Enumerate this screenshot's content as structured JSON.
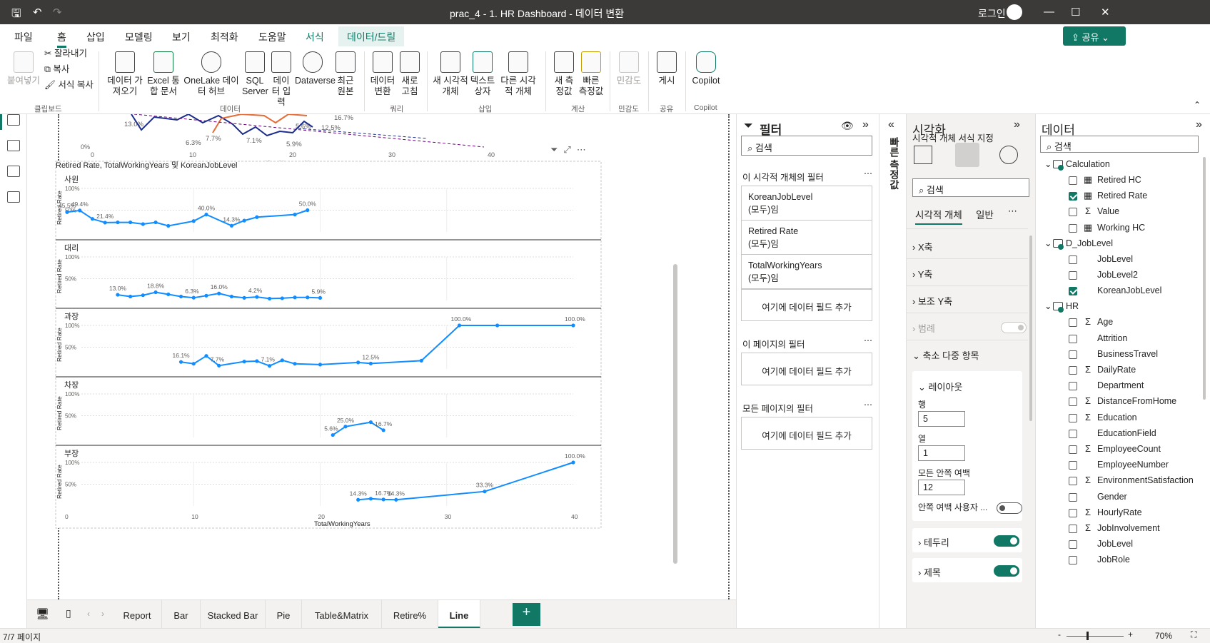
{
  "window": {
    "title": "prac_4 - 1. HR Dashboard - 데이터 변환",
    "login": "로그인"
  },
  "tabs": [
    "파일",
    "홈",
    "삽입",
    "모델링",
    "보기",
    "최적화",
    "도움말",
    "서식",
    "데이터/드릴"
  ],
  "active_tab": "홈",
  "share_label": "공유",
  "ribbon": {
    "clipboard": {
      "paste": "붙여넣기",
      "cut": "잘라내기",
      "copy": "복사",
      "format_copy": "서식 복사",
      "group": "클립보드"
    },
    "data": {
      "get_data": "데이터 가져오기",
      "excel": "Excel 통합 문서",
      "onelake": "OneLake 데이터 허브",
      "sql": "SQL Server",
      "enter": "데이터 입력",
      "dataverse": "Dataverse",
      "recent": "최근 원본",
      "group": "데이터"
    },
    "query": {
      "transform": "데이터 변환",
      "refresh": "새로 고침",
      "group": "쿼리"
    },
    "insert": {
      "new_visual": "새 시각적 개체",
      "textbox": "텍스트 상자",
      "other_visual": "다른 시각적 개체",
      "group": "삽입"
    },
    "calc": {
      "new_measure": "새 측정값",
      "quick_measure": "빠른 측정값",
      "group": "계산"
    },
    "sensitivity": {
      "label": "민감도",
      "group": "민감도"
    },
    "share": {
      "publish": "게시",
      "group": "공유"
    },
    "copilot": {
      "label": "Copilot",
      "group": "Copilot"
    }
  },
  "top_chart_fragment": {
    "labels": [
      "13.0%",
      "6.3%",
      "7.7%",
      "7.1%",
      "5.9%",
      "5.6%",
      "12.5%",
      "16.7%"
    ],
    "x_ticks": [
      "0",
      "10",
      "20",
      "30",
      "40"
    ],
    "y_tick": "0%",
    "xlabel": "TotalWorkingYears"
  },
  "visual": {
    "title": "Retired Rate, TotalWorkingYears 및 KoreanJobLevel",
    "xlabel": "TotalWorkingYears",
    "ylabel": "Retired Rate"
  },
  "chart_data": [
    {
      "type": "line",
      "title": "사원",
      "xlabel": "TotalWorkingYears",
      "ylabel": "Retired Rate",
      "xlim": [
        0,
        40
      ],
      "ylim": [
        0,
        1
      ],
      "y_ticks": [
        "100%",
        "50%"
      ],
      "x": [
        0,
        1,
        2,
        3,
        4,
        5,
        6,
        7,
        8,
        10,
        11,
        13,
        14,
        15,
        18,
        19
      ],
      "y": [
        0.455,
        0.494,
        0.3,
        0.214,
        0.22,
        0.22,
        0.18,
        0.22,
        0.14,
        0.25,
        0.4,
        0.143,
        0.26,
        0.34,
        0.4,
        0.5
      ],
      "labels": [
        {
          "x": 0,
          "text": "45.5%"
        },
        {
          "x": 1,
          "text": "49.4%"
        },
        {
          "x": 3,
          "text": "21.4%"
        },
        {
          "x": 11,
          "text": "40.0%"
        },
        {
          "x": 13,
          "text": "14.3%"
        },
        {
          "x": 19,
          "text": "50.0%"
        }
      ]
    },
    {
      "type": "line",
      "title": "대리",
      "xlabel": "TotalWorkingYears",
      "ylabel": "Retired Rate",
      "xlim": [
        0,
        40
      ],
      "ylim": [
        0,
        1
      ],
      "y_ticks": [
        "100%",
        "50%"
      ],
      "x": [
        4,
        5,
        6,
        7,
        8,
        9,
        10,
        11,
        12,
        13,
        14,
        15,
        16,
        17,
        18,
        19,
        20
      ],
      "y": [
        0.13,
        0.09,
        0.12,
        0.188,
        0.14,
        0.09,
        0.063,
        0.11,
        0.16,
        0.09,
        0.06,
        0.08,
        0.042,
        0.05,
        0.07,
        0.07,
        0.059
      ],
      "labels": [
        {
          "x": 4,
          "text": "13.0%"
        },
        {
          "x": 7,
          "text": "18.8%"
        },
        {
          "x": 10,
          "text": "6.3%"
        },
        {
          "x": 12,
          "text": "16.0%"
        },
        {
          "x": 15,
          "text": "4.2%"
        },
        {
          "x": 20,
          "text": "5.9%"
        }
      ]
    },
    {
      "type": "line",
      "title": "과장",
      "xlabel": "TotalWorkingYears",
      "ylabel": "Retired Rate",
      "xlim": [
        0,
        40
      ],
      "ylim": [
        0,
        1
      ],
      "y_ticks": [
        "100%",
        "50%"
      ],
      "x": [
        9,
        10,
        11,
        12,
        14,
        15,
        16,
        17,
        18,
        20,
        23,
        24,
        28,
        31,
        34,
        40
      ],
      "y": [
        0.161,
        0.12,
        0.3,
        0.077,
        0.17,
        0.18,
        0.071,
        0.2,
        0.12,
        0.1,
        0.15,
        0.125,
        0.19,
        1.0,
        1.0,
        1.0
      ],
      "labels": [
        {
          "x": 9,
          "text": "16.1%"
        },
        {
          "x": 12,
          "text": "7.7%"
        },
        {
          "x": 16,
          "text": "7.1%"
        },
        {
          "x": 24,
          "text": "12.5%"
        },
        {
          "x": 31,
          "text": "100.0%"
        },
        {
          "x": 40,
          "text": "100.0%"
        }
      ]
    },
    {
      "type": "line",
      "title": "차장",
      "xlabel": "TotalWorkingYears",
      "ylabel": "Retired Rate",
      "xlim": [
        0,
        40
      ],
      "ylim": [
        0,
        1
      ],
      "y_ticks": [
        "100%",
        "50%"
      ],
      "x": [
        21,
        22,
        24,
        25
      ],
      "y": [
        0.056,
        0.25,
        0.35,
        0.167
      ],
      "labels": [
        {
          "x": 21,
          "text": "5.6%"
        },
        {
          "x": 22,
          "text": "25.0%"
        },
        {
          "x": 25,
          "text": "16.7%"
        }
      ]
    },
    {
      "type": "line",
      "title": "부장",
      "xlabel": "TotalWorkingYears",
      "ylabel": "Retired Rate",
      "xlim": [
        0,
        40
      ],
      "ylim": [
        0,
        1
      ],
      "y_ticks": [
        "100%",
        "50%"
      ],
      "x": [
        23,
        24,
        25,
        26,
        33,
        40
      ],
      "y": [
        0.143,
        0.167,
        0.15,
        0.143,
        0.333,
        1.0
      ],
      "x_ticks": [
        "0",
        "10",
        "20",
        "30",
        "40"
      ],
      "labels": [
        {
          "x": 23,
          "text": "14.3%"
        },
        {
          "x": 25,
          "text": "16.7%"
        },
        {
          "x": 26,
          "text": "14.3%"
        },
        {
          "x": 33,
          "text": "33.3%"
        },
        {
          "x": 40,
          "text": "100.0%"
        }
      ]
    }
  ],
  "filters": {
    "title": "필터",
    "search": "검색",
    "visual_section": "이 시각적 개체의 필터",
    "cards": [
      {
        "name": "KoreanJobLevel",
        "value": "(모두)임"
      },
      {
        "name": "Retired Rate",
        "value": "(모두)임"
      },
      {
        "name": "TotalWorkingYears",
        "value": "(모두)임"
      }
    ],
    "add_field": "여기에 데이터 필드 추가",
    "page_section": "이 페이지의 필터",
    "all_section": "모든 페이지의 필터"
  },
  "quick_measure_vertical": "빠른 측정값",
  "viz_pane": {
    "title": "시각화",
    "subtitle": "시각적 개체 서식 지정",
    "search": "검색",
    "tabs": [
      "시각적 개체",
      "일반"
    ],
    "sections": [
      "X축",
      "Y축",
      "보조 Y축",
      "범례",
      "축소 다중 항목"
    ],
    "layout": {
      "title": "레이아웃",
      "row_label": "행",
      "row": "5",
      "col_label": "열",
      "col": "1",
      "padding_label": "모든 안쪽 여백",
      "padding": "12",
      "custom_label": "안쪽 여백 사용자 ..."
    },
    "border": "테두리",
    "title_section": "제목"
  },
  "data_pane": {
    "title": "데이터",
    "search": "검색",
    "tables": [
      {
        "name": "Calculation",
        "fields": [
          {
            "name": "Retired HC",
            "sym": "▦",
            "checked": false
          },
          {
            "name": "Retired Rate",
            "sym": "▦",
            "checked": true
          },
          {
            "name": "Value",
            "sym": "Σ",
            "checked": false
          },
          {
            "name": "Working HC",
            "sym": "▦",
            "checked": false
          }
        ]
      },
      {
        "name": "D_JobLevel",
        "fields": [
          {
            "name": "JobLevel",
            "sym": "",
            "checked": false
          },
          {
            "name": "JobLevel2",
            "sym": "",
            "checked": false
          },
          {
            "name": "KoreanJobLevel",
            "sym": "",
            "checked": true
          }
        ]
      },
      {
        "name": "HR",
        "fields": [
          {
            "name": "Age",
            "sym": "Σ",
            "checked": false
          },
          {
            "name": "Attrition",
            "sym": "",
            "checked": false
          },
          {
            "name": "BusinessTravel",
            "sym": "",
            "checked": false
          },
          {
            "name": "DailyRate",
            "sym": "Σ",
            "checked": false
          },
          {
            "name": "Department",
            "sym": "",
            "checked": false
          },
          {
            "name": "DistanceFromHome",
            "sym": "Σ",
            "checked": false
          },
          {
            "name": "Education",
            "sym": "Σ",
            "checked": false
          },
          {
            "name": "EducationField",
            "sym": "",
            "checked": false
          },
          {
            "name": "EmployeeCount",
            "sym": "Σ",
            "checked": false
          },
          {
            "name": "EmployeeNumber",
            "sym": "",
            "checked": false
          },
          {
            "name": "EnvironmentSatisfaction",
            "sym": "Σ",
            "checked": false
          },
          {
            "name": "Gender",
            "sym": "",
            "checked": false
          },
          {
            "name": "HourlyRate",
            "sym": "Σ",
            "checked": false
          },
          {
            "name": "JobInvolvement",
            "sym": "Σ",
            "checked": false
          },
          {
            "name": "JobLevel",
            "sym": "",
            "checked": false
          },
          {
            "name": "JobRole",
            "sym": "",
            "checked": false
          }
        ]
      }
    ]
  },
  "page_tabs": [
    "Report",
    "Bar",
    "Stacked Bar",
    "Pie",
    "Table&Matrix",
    "Retire%",
    "Line"
  ],
  "active_page": "Line",
  "status": {
    "page": "7/7 페이지",
    "zoom": "70%"
  },
  "colors": {
    "accent": "#117865",
    "line": "#118dff",
    "titlebar": "#3b3a39"
  }
}
